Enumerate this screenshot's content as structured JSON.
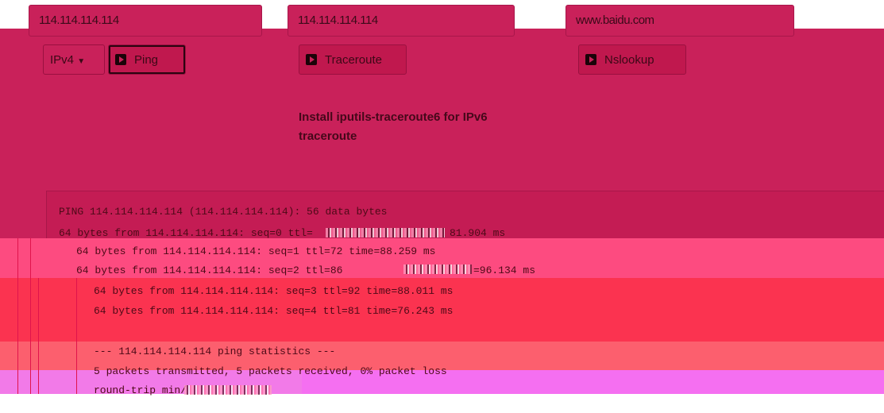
{
  "inputs": {
    "ping_host": "114.114.114.114",
    "traceroute_host": "114.114.114.114",
    "nslookup_host": "www.baidu.com"
  },
  "controls": {
    "ip_version": "IPv4",
    "ping_label": "Ping",
    "traceroute_label": "Traceroute",
    "nslookup_label": "Nslookup"
  },
  "notice": "Install iputils-traceroute6 for IPv6 traceroute",
  "output": {
    "lines": [
      "PING 114.114.114.114 (114.114.114.114): 56 data bytes",
      "64 bytes from 114.114.114.114: seq=0 ttl=",
      "81.904 ms",
      "64 bytes from 114.114.114.114: seq=1 ttl=72 time=88.259 ms",
      "64 bytes from 114.114.114.114: seq=2 ttl=86",
      "=96.134 ms",
      "64 bytes from 114.114.114.114: seq=3 ttl=92 time=88.011 ms",
      "64 bytes from 114.114.114.114: seq=4 ttl=81 time=76.243 ms",
      "--- 114.114.114.114 ping statistics ---",
      "5 packets transmitted, 5 packets received, 0% packet loss",
      "round-trip min/"
    ]
  },
  "colors": {
    "band": "#c9215a",
    "stripe_pink": "#fd4b80",
    "stripe_red": "#fb3350",
    "stripe_magenta": "#f56ff1"
  },
  "icons": [
    "play-icon"
  ]
}
